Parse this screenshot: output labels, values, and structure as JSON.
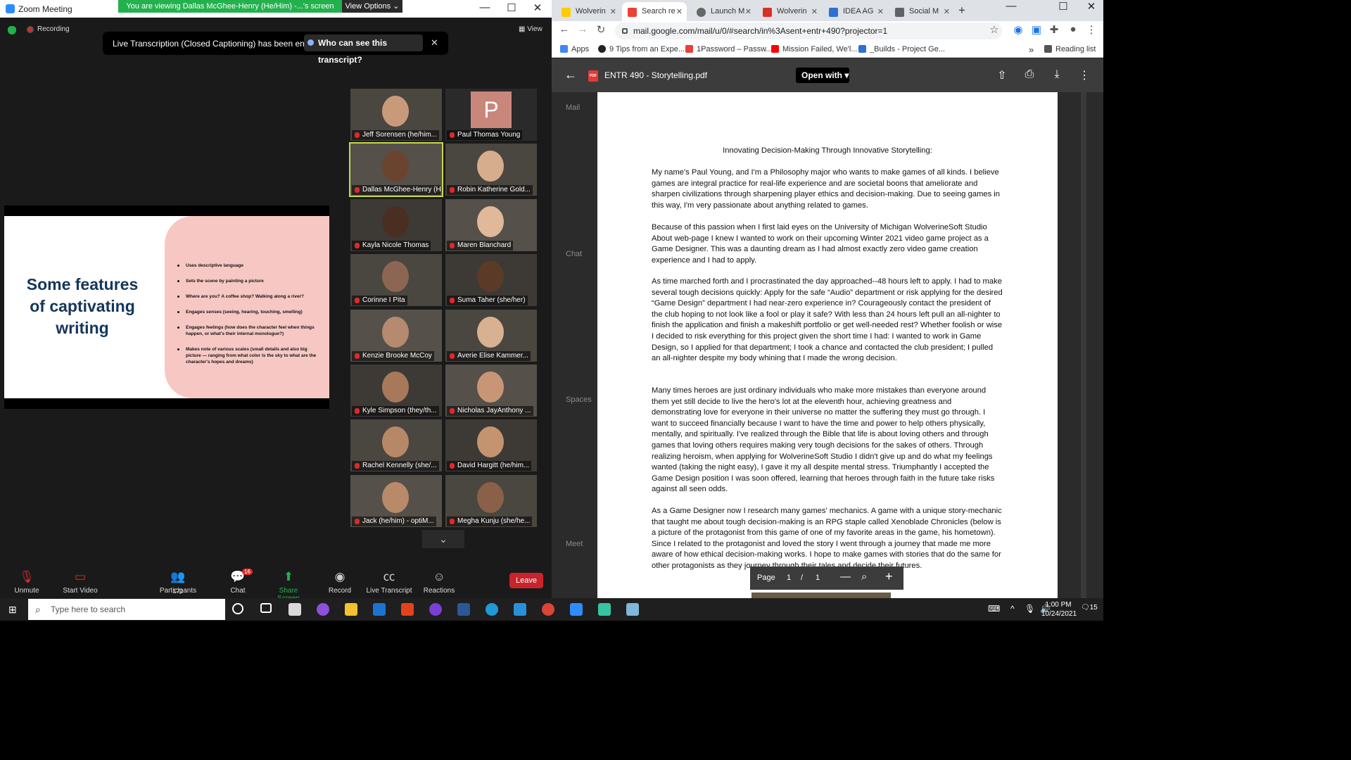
{
  "zoom": {
    "window_title": "Zoom Meeting",
    "share_banner": "You are viewing Dallas McGhee-Henry (He/Him) -...'s screen",
    "view_options": "View Options ⌄",
    "recording": "Recording",
    "view": "View",
    "transcript_msg": "Live Transcription (Closed Captioning) has been enabled",
    "transcript_who": "Who can see this transcript?",
    "slide": {
      "heading": "Some features of captivating writing",
      "bullets": [
        "Uses descriptive language",
        "Sets the scene by painting a picture",
        "Where are you? A coffee shop? Walking along a river?",
        "Engages senses (seeing, hearing, touching, smelling)",
        "Engages feelings (how does the character feel when things happen, or what's their internal monologue?)",
        "Makes note of various scales (small details and also big picture — ranging from what color is the sky to what are the character's hopes and dreams)"
      ]
    },
    "participants": [
      "Jeff Sorensen (he/him...",
      "Paul Thomas Young",
      "Dallas McGhee-Henry (H...",
      "Robin Katherine Gold...",
      "Kayla Nicole Thomas",
      "Maren Blanchard",
      "Corinne I Pita",
      "Suma Taher (she/her)",
      "Kenzie Brooke McCoy",
      "Averie Elise Kammer...",
      "Kyle Simpson (they/th...",
      "Nicholas JayAnthony ...",
      "Rachel Kennelly (she/...",
      "David Hargitt (he/him...",
      "Jack (he/him) - optiM...",
      "Megha Kunju (she/he..."
    ],
    "avatar_letter": "P",
    "toolbar": {
      "unmute": "Unmute",
      "start_video": "Start Video",
      "participants": "Participants",
      "participant_count": "171",
      "chat": "Chat",
      "chat_badge": "16",
      "share_screen": "Share Screen",
      "record": "Record",
      "live_transcript": "Live Transcript",
      "reactions": "Reactions",
      "leave": "Leave"
    }
  },
  "chrome": {
    "tabs": [
      "Wolverin",
      "Search re",
      "Launch M",
      "Wolverin",
      "IDEA AG",
      "Social M"
    ],
    "url": "mail.google.com/mail/u/0/#search/in%3Asent+entr+490?projector=1",
    "bookmarks": [
      "Apps",
      "9 Tips from an Expe...",
      "1Password – Passw...",
      "Mission Failed, We'l...",
      "_Builds - Project Ge..."
    ],
    "reading_list": "Reading list",
    "viewer_title": "ENTR 490 - Storytelling.pdf",
    "open_with": "Open with",
    "gmail_side": [
      "Mail",
      "Chat",
      "Spaces",
      "Meet"
    ],
    "doc": {
      "title": "Innovating Decision-Making Through Innovative Storytelling:",
      "paragraphs": [
        "My name's Paul Young, and I'm a Philosophy major who wants to make games of all kinds. I believe games are integral practice for real-life experience and are societal boons that ameliorate and sharpen civilizations through sharpening player ethics and decision-making. Due to seeing games in this way, I'm very passionate about anything related to games.",
        "Because of this passion when I first laid eyes on the University of Michigan WolverineSoft Studio About web-page I knew I wanted to work on their upcoming Winter 2021 video game project as a Game Designer. This was a daunting dream as I had almost exactly zero video game creation experience and I had to apply.",
        "As time marched forth and I procrastinated the day approached--48 hours left to apply. I had to make several tough decisions quickly: Apply for the safe “Audio” department or risk applying for the desired “Game Design” department I had near-zero experience in? Courageously contact the president of the club hoping to not look like a fool or play it safe? With less than 24 hours left pull an all-nighter to finish the application and finish a makeshift portfolio or get well-needed rest? Whether foolish or wise I decided to risk everything for this project given the short time I had: I wanted to work in Game Design, so I applied for that department; I took a chance and contacted the club president; I pulled an all-nighter despite my body whining that I made the wrong decision.",
        "Many times heroes are just ordinary individuals who make more mistakes than everyone around them yet still decide to live the hero's lot at the eleventh hour, achieving greatness and demonstrating love for everyone in their universe no matter the suffering they must go through. I want to succeed financially because I want to have the time and power to help others physically, mentally, and spiritually. I've realized through the Bible that life is about loving others and through games that loving others requires making very tough decisions for the sakes of others. Through realizing heroism, when applying for WolverineSoft Studio I didn't give up and do what my feelings wanted (taking the night easy), I gave it my all despite mental stress. Triumphantly I accepted the Game Design position I was soon offered, learning that heroes through faith in the future take risks against all seen odds.",
        "As a Game Designer now I research many games' mechanics. A game with a unique story-mechanic that taught me about tough decision-making is an RPG staple called Xenoblade Chronicles (below is a picture of the protagonist from this game of one of my favorite areas in the game, his hometown). Since I related to the protagonist and loved the story I went through a journey that made me more aware of how ethical decision-making works. I hope to make games with stories that do the same for other protagonists as they journey through their tales and decide their futures."
      ]
    },
    "page_ctl": {
      "label": "Page",
      "current": "1",
      "sep": "/",
      "total": "1"
    }
  },
  "taskbar": {
    "search_placeholder": "Type here to search",
    "time": "1:00 PM",
    "date": "10/24/2021",
    "notif": "15"
  }
}
